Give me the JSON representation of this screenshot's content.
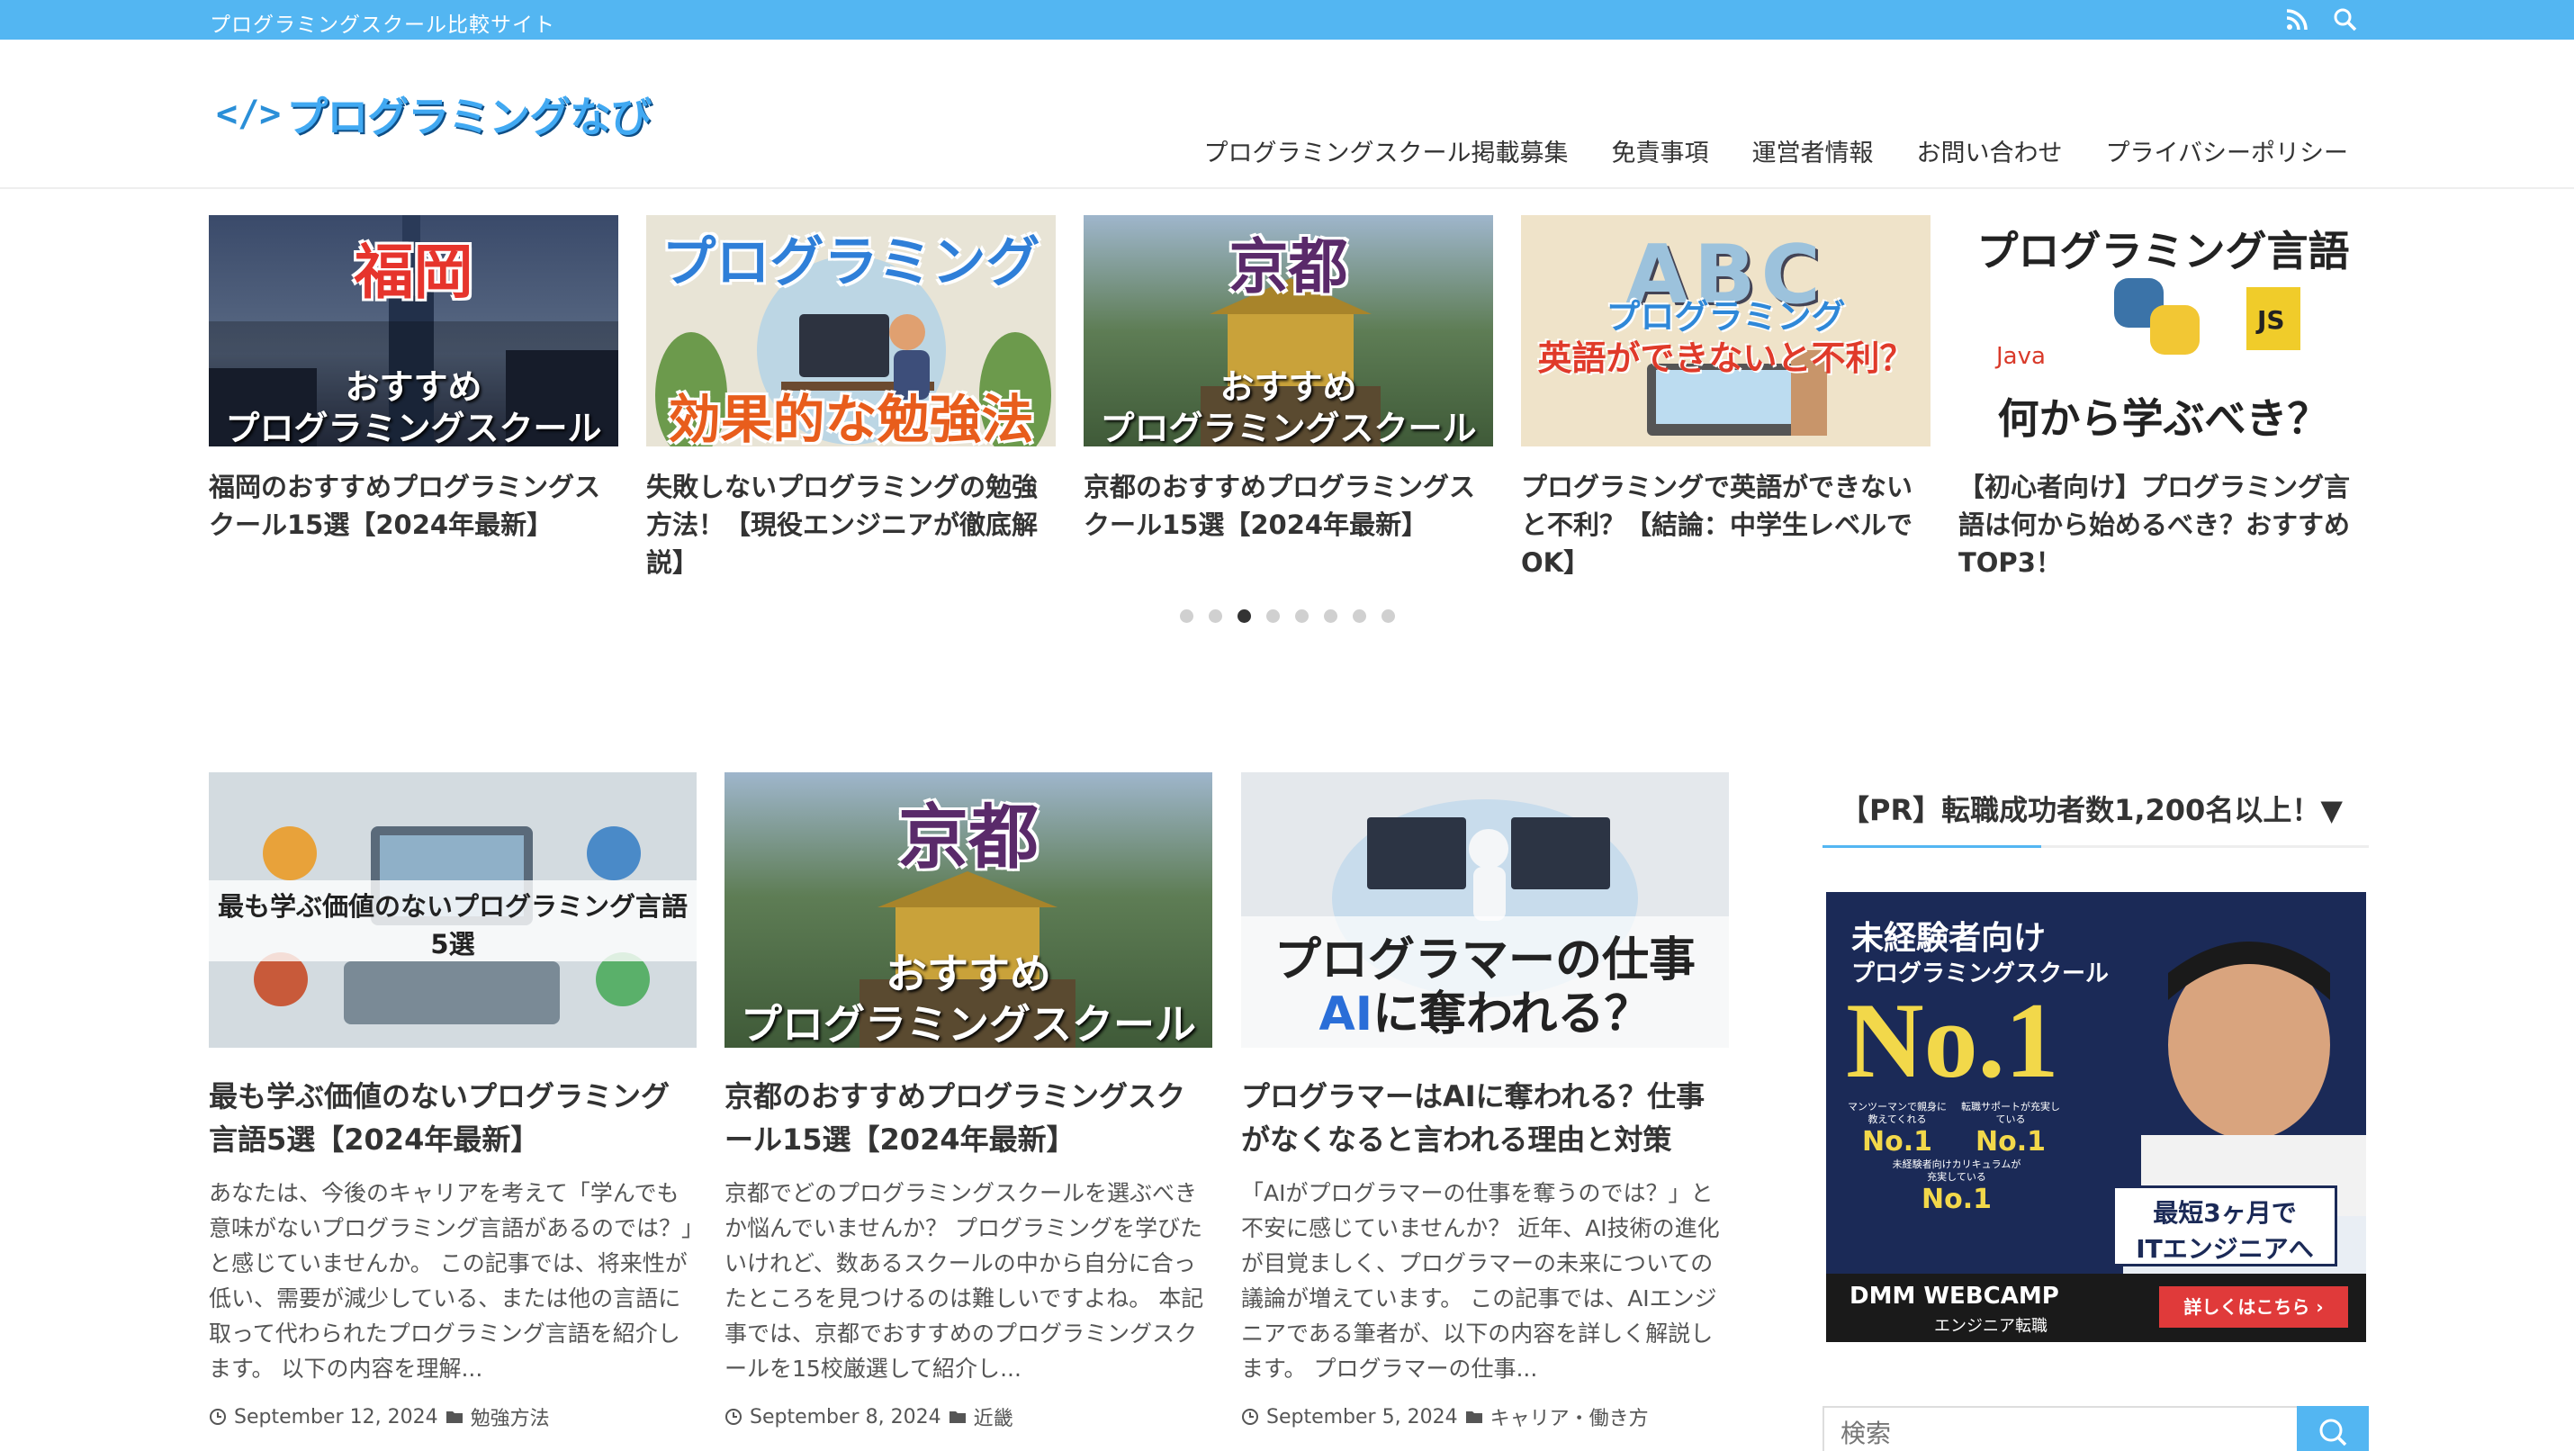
{
  "topbar": {
    "tagline": "プログラミングスクール比較サイト",
    "icons": [
      "rss-icon",
      "search-icon"
    ]
  },
  "header": {
    "logo_code": "</>",
    "logo_text": "プログラミングなび",
    "nav": [
      "プログラミングスクール掲載募集",
      "免責事項",
      "運営者情報",
      "お問い合わせ",
      "プライバシーポリシー"
    ]
  },
  "slider": {
    "slides": [
      {
        "title": "福岡のおすすめプログラミングスクール15選【2024年最新】",
        "img_heading": "福岡",
        "img_line1": "おすすめ",
        "img_line2": "プログラミングスクール"
      },
      {
        "title": "失敗しないプログラミングの勉強方法！【現役エンジニアが徹底解説】",
        "img_heading": "プログラミング",
        "img_line1": "効果的な勉強法"
      },
      {
        "title": "京都のおすすめプログラミングスクール15選【2024年最新】",
        "img_heading": "京都",
        "img_line1": "おすすめ",
        "img_line2": "プログラミングスクール"
      },
      {
        "title": "プログラミングで英語ができないと不利？【結論：中学生レベルでOK】",
        "img_heading": "ABC",
        "img_line1": "プログラミング",
        "img_line2": "英語ができないと不利？"
      },
      {
        "title": "【初心者向け】プログラミング言語は何から始めるべき？おすすめTOP3！",
        "img_heading": "プログラミング言語",
        "img_java": "Java",
        "img_js": "JS",
        "img_line1": "何から学ぶべき？"
      }
    ],
    "dot_count": 8,
    "active_dot": 2
  },
  "articles": [
    {
      "img_line1": "最も学ぶ価値のないプログラミング言語",
      "img_line2": "5選",
      "title": "最も学ぶ価値のないプログラミング言語5選【2024年最新】",
      "excerpt": "あなたは、今後のキャリアを考えて「学んでも意味がないプログラミング言語があるのでは？」と感じていませんか。 この記事では、将来性が低い、需要が減少している、または他の言語に取って代わられたプログラミング言語を紹介します。 以下の内容を理解...",
      "date": "September 12, 2024",
      "category": "勉強方法"
    },
    {
      "img_heading": "京都",
      "img_line1": "おすすめ",
      "img_line2": "プログラミングスクール",
      "title": "京都のおすすめプログラミングスクール15選【2024年最新】",
      "excerpt": "京都でどのプログラミングスクールを選ぶべきか悩んでいませんか？ プログラミングを学びたいけれど、数あるスクールの中から自分に合ったところを見つけるのは難しいですよね。 本記事では、京都でおすすめのプログラミングスクールを15校厳選して紹介し...",
      "date": "September 8, 2024",
      "category": "近畿"
    },
    {
      "img_line1": "プログラマーの仕事",
      "img_line2a": "AI",
      "img_line2b": "に奪われる？",
      "title": "プログラマーはAIに奪われる？仕事がなくなると言われる理由と対策",
      "excerpt": "「AIがプログラマーの仕事を奪うのでは？」と不安に感じていませんか？ 近年、AI技術の進化が目覚ましく、プログラマーの未来についての議論が増えています。 この記事では、AIエンジニアである筆者が、以下の内容を詳しく解説します。 プログラマーの仕事...",
      "date": "September 5, 2024",
      "category": "キャリア・働き方"
    }
  ],
  "sidebar": {
    "title": "【PR】転職成功者数1,200名以上！▼",
    "ad": {
      "headline": "未経験者向け",
      "subhead": "プログラミングスクール",
      "no1": "No.1",
      "badge1_label": "マンツーマンで親身に教えてくれる",
      "badge1": "No.1",
      "badge2_label": "転職サポートが充実している",
      "badge2": "No.1",
      "badge3_label": "未経験者向けカリキュラムが充実している",
      "badge3": "No.1",
      "callout_line1": "最短3ヶ月で",
      "callout_line2": "ITエンジニアへ",
      "brand": "DMM WEBCAMP",
      "brand_sub": "エンジニア転職",
      "cta": "詳しくはこちら ›"
    },
    "search_placeholder": "検索"
  },
  "colors": {
    "accent": "#53b6f2",
    "text": "#333333"
  }
}
